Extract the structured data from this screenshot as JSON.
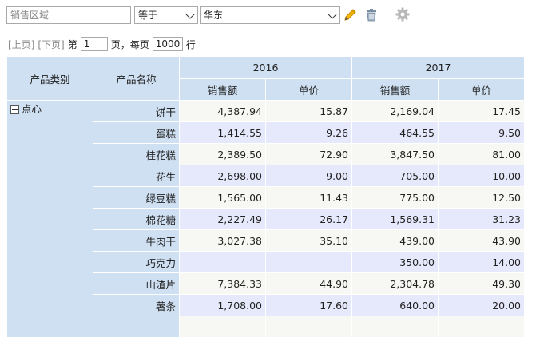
{
  "filter": {
    "field_placeholder": "销售区域",
    "operator": "等于",
    "value": "华东"
  },
  "pager": {
    "prev": "[上页]",
    "next": "[下页]",
    "page_prefix": "第",
    "page": "1",
    "page_suffix": "页，每页",
    "page_size": "1000",
    "rows_suffix": "行"
  },
  "table": {
    "headers": {
      "category": "产品类别",
      "name": "产品名称",
      "years": [
        "2016",
        "2017"
      ],
      "measures": [
        "销售额",
        "单价",
        "销售额",
        "单价"
      ]
    },
    "category": "点心",
    "rows": [
      {
        "name": "饼干",
        "v": [
          "4,387.94",
          "15.87",
          "2,169.04",
          "17.45"
        ]
      },
      {
        "name": "蛋糕",
        "v": [
          "1,414.55",
          "9.26",
          "464.55",
          "9.50"
        ]
      },
      {
        "name": "桂花糕",
        "v": [
          "2,389.50",
          "72.90",
          "3,847.50",
          "81.00"
        ]
      },
      {
        "name": "花生",
        "v": [
          "2,698.00",
          "9.00",
          "705.00",
          "10.00"
        ]
      },
      {
        "name": "绿豆糕",
        "v": [
          "1,565.00",
          "11.43",
          "775.00",
          "12.50"
        ]
      },
      {
        "name": "棉花糖",
        "v": [
          "2,227.49",
          "26.17",
          "1,569.31",
          "31.23"
        ]
      },
      {
        "name": "牛肉干",
        "v": [
          "3,027.38",
          "35.10",
          "439.00",
          "43.90"
        ]
      },
      {
        "name": "巧克力",
        "v": [
          "",
          "",
          "350.00",
          "14.00"
        ]
      },
      {
        "name": "山渣片",
        "v": [
          "7,384.33",
          "44.90",
          "2,304.78",
          "49.30"
        ]
      },
      {
        "name": "薯条",
        "v": [
          "1,708.00",
          "17.60",
          "640.00",
          "20.00"
        ]
      }
    ]
  },
  "icons": {
    "edit": "pencil-icon",
    "delete": "trash-icon",
    "settings": "gear-icon"
  },
  "colors": {
    "header_bg": "#cfe0f2",
    "row_odd": "#f7f7f4",
    "row_even": "#e6e8fb",
    "pencil": "#e0a100"
  }
}
